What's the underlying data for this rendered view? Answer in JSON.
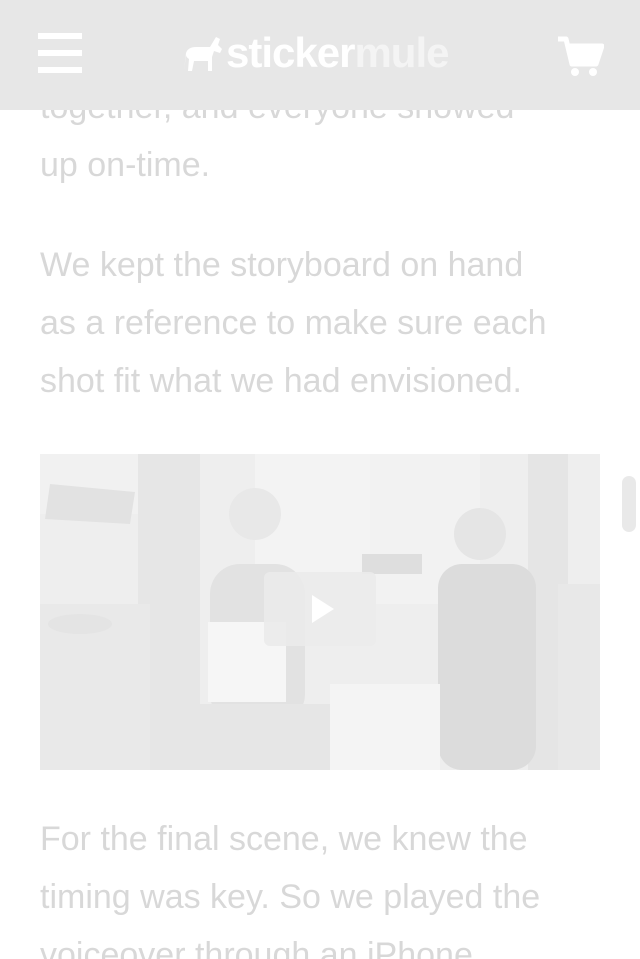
{
  "header": {
    "logo_text_part1": "sticker",
    "logo_text_part2": "mule",
    "menu_icon": "hamburger-menu-icon",
    "cart_icon": "shopping-cart-icon"
  },
  "article": {
    "paragraph1": {
      "lines": [
        "together, and everyone showed",
        "up on-time."
      ]
    },
    "paragraph2": {
      "lines": [
        "We kept the storyboard on hand",
        "as a reference to make sure each",
        "shot fit what we had envisioned."
      ]
    },
    "paragraph3": {
      "lines": [
        "For the final scene, we knew the",
        "timing was key. So we played the",
        "voiceover through an iPhone"
      ]
    }
  },
  "video": {
    "play_icon": "play-icon"
  },
  "colors": {
    "header_bg": "#e7e7e7",
    "text": "#d8d8d8",
    "icon": "#ffffff"
  }
}
